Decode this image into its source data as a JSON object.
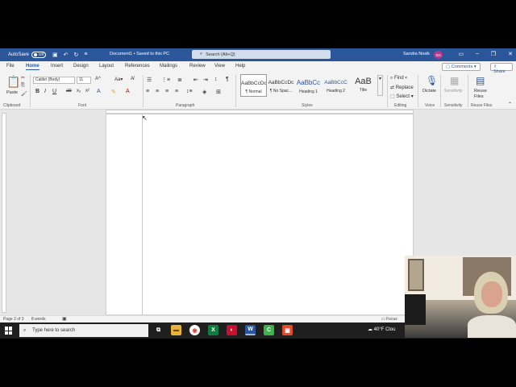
{
  "titlebar": {
    "autosave_label": "AutoSave",
    "autosave_state": "Off",
    "doc_title": "Document1 • Saved to this PC",
    "search_placeholder": "Search (Alt+Q)",
    "user_name": "Sandra Nosik",
    "user_initials": "SN"
  },
  "tabs": [
    "File",
    "Home",
    "Insert",
    "Design",
    "Layout",
    "References",
    "Mailings",
    "Review",
    "View",
    "Help"
  ],
  "active_tab": "Home",
  "comments_label": "Comments",
  "share_label": "Share",
  "ribbon": {
    "clipboard": {
      "paste_label": "Paste",
      "group": "Clipboard"
    },
    "font": {
      "font_name": "Calibri (Body)",
      "font_size": "11",
      "group": "Font"
    },
    "paragraph": {
      "group": "Paragraph"
    },
    "styles": {
      "group": "Styles",
      "items": [
        {
          "sample": "AaBbCcDc",
          "name": "¶ Normal"
        },
        {
          "sample": "AaBbCcDc",
          "name": "¶ No Spac..."
        },
        {
          "sample": "AaBbCc",
          "name": "Heading 1"
        },
        {
          "sample": "AaBbCcC",
          "name": "Heading 2"
        },
        {
          "sample": "AaB",
          "name": "Title"
        }
      ]
    },
    "editing": {
      "group": "Editing",
      "find": "Find",
      "replace": "Replace",
      "select": "Select"
    },
    "voice": {
      "group": "Voice",
      "dictate": "Dictate"
    },
    "sensitivity": {
      "group": "Sensitivity",
      "label": "Sensitivity"
    },
    "reuse": {
      "group": "Reuse Files",
      "label": "Reuse Files"
    }
  },
  "status": {
    "page": "Page 2 of 3",
    "words": "8 words",
    "focus": "Focus"
  },
  "taskbar": {
    "search_placeholder": "Type here to search",
    "weather": "40°F  Clou"
  }
}
